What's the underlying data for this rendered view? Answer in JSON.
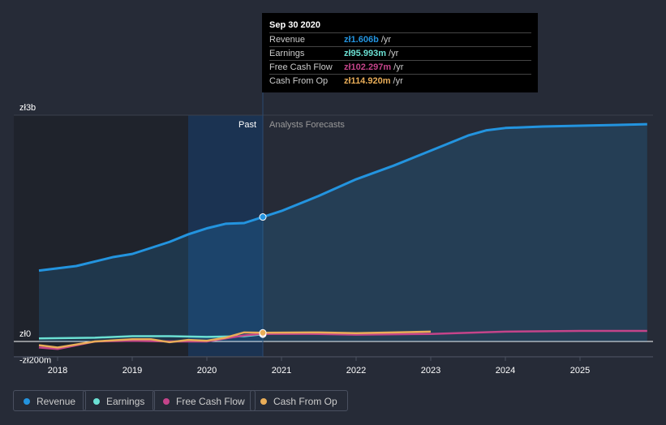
{
  "tooltip": {
    "date": "Sep 30 2020",
    "rows": [
      {
        "label": "Revenue",
        "value": "zł1.606b",
        "unit": " /yr",
        "color": "#2394df"
      },
      {
        "label": "Earnings",
        "value": "zł95.993m",
        "unit": " /yr",
        "color": "#6be0d3"
      },
      {
        "label": "Free Cash Flow",
        "value": "zł102.297m",
        "unit": " /yr",
        "color": "#c4448a"
      },
      {
        "label": "Cash From Op",
        "value": "zł114.920m",
        "unit": " /yr",
        "color": "#e9ad58"
      }
    ]
  },
  "chart_data": {
    "type": "line",
    "past_label": "Past",
    "forecast_label": "Analysts Forecasts",
    "y_ticks": [
      {
        "v": 3,
        "label": "zł3b"
      },
      {
        "v": 0,
        "label": "zł0"
      },
      {
        "v": -0.2,
        "label": "-zł200m"
      }
    ],
    "x_ticks": [
      "2018",
      "2019",
      "2020",
      "2021",
      "2022",
      "2023",
      "2024",
      "2025"
    ],
    "ylim": [
      -0.2,
      3.0
    ],
    "unit": "billions PLN",
    "divider_x": 2020.75,
    "series": [
      {
        "name": "Revenue",
        "color": "#2394df",
        "area": true,
        "points": [
          [
            2017.75,
            0.94
          ],
          [
            2018.25,
            1.0
          ],
          [
            2018.75,
            1.12
          ],
          [
            2019.0,
            1.16
          ],
          [
            2019.5,
            1.32
          ],
          [
            2019.75,
            1.42
          ],
          [
            2020.0,
            1.5
          ],
          [
            2020.25,
            1.56
          ],
          [
            2020.5,
            1.57
          ],
          [
            2020.75,
            1.65
          ],
          [
            2021.0,
            1.73
          ],
          [
            2021.5,
            1.93
          ],
          [
            2022.0,
            2.15
          ],
          [
            2022.5,
            2.33
          ],
          [
            2023.0,
            2.53
          ],
          [
            2023.5,
            2.73
          ],
          [
            2023.75,
            2.8
          ],
          [
            2024.0,
            2.83
          ],
          [
            2024.5,
            2.85
          ],
          [
            2025.0,
            2.86
          ],
          [
            2025.9,
            2.88
          ]
        ]
      },
      {
        "name": "Earnings",
        "color": "#6be0d3",
        "points": [
          [
            2017.75,
            0.04
          ],
          [
            2018.5,
            0.05
          ],
          [
            2019.0,
            0.07
          ],
          [
            2019.5,
            0.07
          ],
          [
            2020.0,
            0.06
          ],
          [
            2020.5,
            0.07
          ],
          [
            2020.75,
            0.096
          ]
        ]
      },
      {
        "name": "Free Cash Flow",
        "color": "#c4448a",
        "points": [
          [
            2017.75,
            -0.08
          ],
          [
            2018.0,
            -0.1
          ],
          [
            2018.5,
            0.0
          ],
          [
            2019.0,
            0.01
          ],
          [
            2019.5,
            0.0
          ],
          [
            2020.0,
            0.0
          ],
          [
            2020.5,
            0.08
          ],
          [
            2020.75,
            0.102
          ],
          [
            2021.5,
            0.1
          ],
          [
            2022.0,
            0.09
          ],
          [
            2023.0,
            0.1
          ],
          [
            2024.0,
            0.13
          ],
          [
            2025.0,
            0.14
          ],
          [
            2025.9,
            0.14
          ]
        ]
      },
      {
        "name": "Cash From Op",
        "color": "#e9ad58",
        "points": [
          [
            2017.75,
            -0.05
          ],
          [
            2018.0,
            -0.08
          ],
          [
            2018.5,
            0.0
          ],
          [
            2019.0,
            0.03
          ],
          [
            2019.25,
            0.03
          ],
          [
            2019.5,
            -0.01
          ],
          [
            2019.75,
            0.02
          ],
          [
            2020.0,
            0.01
          ],
          [
            2020.25,
            0.05
          ],
          [
            2020.5,
            0.12
          ],
          [
            2020.75,
            0.115
          ],
          [
            2021.5,
            0.12
          ],
          [
            2022.0,
            0.11
          ],
          [
            2022.5,
            0.12
          ],
          [
            2023.0,
            0.13
          ]
        ]
      }
    ]
  },
  "legend": [
    "Revenue",
    "Earnings",
    "Free Cash Flow",
    "Cash From Op"
  ]
}
